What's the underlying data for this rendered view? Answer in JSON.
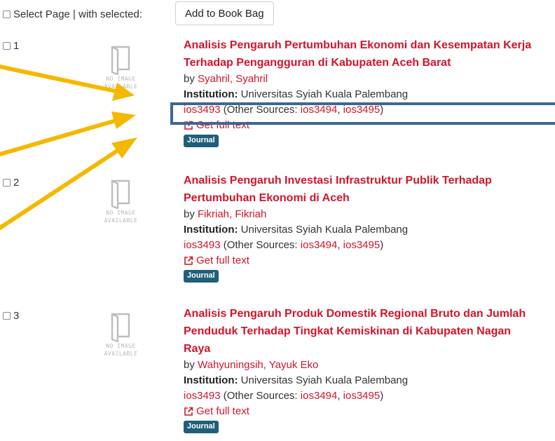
{
  "toolbar": {
    "select_label": "Select Page | with selected:",
    "bookbag_button": "Add to Book Bag"
  },
  "thumbnail": {
    "line1": "NO IMAGE",
    "line2": "AVAILABLE"
  },
  "colors": {
    "link": "#d2152a",
    "badge": "#1f5f7a",
    "highlight": "#3c6893",
    "arrow": "#f5b800"
  },
  "icons": {
    "thumbnail": "book-icon",
    "fulltext": "external-link-icon"
  },
  "results": [
    {
      "number": "1",
      "title_line1": "Analisis Pengaruh Pertumbuhan Ekonomi dan Kesempatan Kerja",
      "title_line2": "Terhadap Pengangguran di Kabupaten Aceh Barat",
      "title_line3": "",
      "by": "by",
      "author": "Syahril, Syahril",
      "institution_label": "Institution:",
      "institution": "Universitas Syiah Kuala Palembang",
      "source": "ios3493",
      "other_prefix": " (Other Sources: ",
      "other1": "ios3494",
      "sep": ", ",
      "other2": "ios3495",
      "other_suffix": ")",
      "fulltext": "Get full text",
      "badge": "Journal"
    },
    {
      "number": "2",
      "title_line1": "Analisis Pengaruh Investasi Infrastruktur Publik Terhadap",
      "title_line2": "Pertumbuhan Ekonomi di Aceh",
      "title_line3": "",
      "by": "by",
      "author": "Fikriah, Fikriah",
      "institution_label": "Institution:",
      "institution": "Universitas Syiah Kuala Palembang",
      "source": "ios3493",
      "other_prefix": " (Other Sources: ",
      "other1": "ios3494",
      "sep": ", ",
      "other2": "ios3495",
      "other_suffix": ")",
      "fulltext": "Get full text",
      "badge": "Journal"
    },
    {
      "number": "3",
      "title_line1": "Analisis Pengaruh Produk Domestik Regional Bruto dan Jumlah",
      "title_line2": "Penduduk Terhadap Tingkat Kemiskinan di Kabupaten Nagan",
      "title_line3": "Raya",
      "by": "by",
      "author": "Wahyuningsih, Yayuk Eko",
      "institution_label": "Institution:",
      "institution": "Universitas Syiah Kuala Palembang",
      "source": "ios3493",
      "other_prefix": " (Other Sources: ",
      "other1": "ios3494",
      "sep": ", ",
      "other2": "ios3495",
      "other_suffix": ")",
      "fulltext": "Get full text",
      "badge": "Journal"
    }
  ]
}
